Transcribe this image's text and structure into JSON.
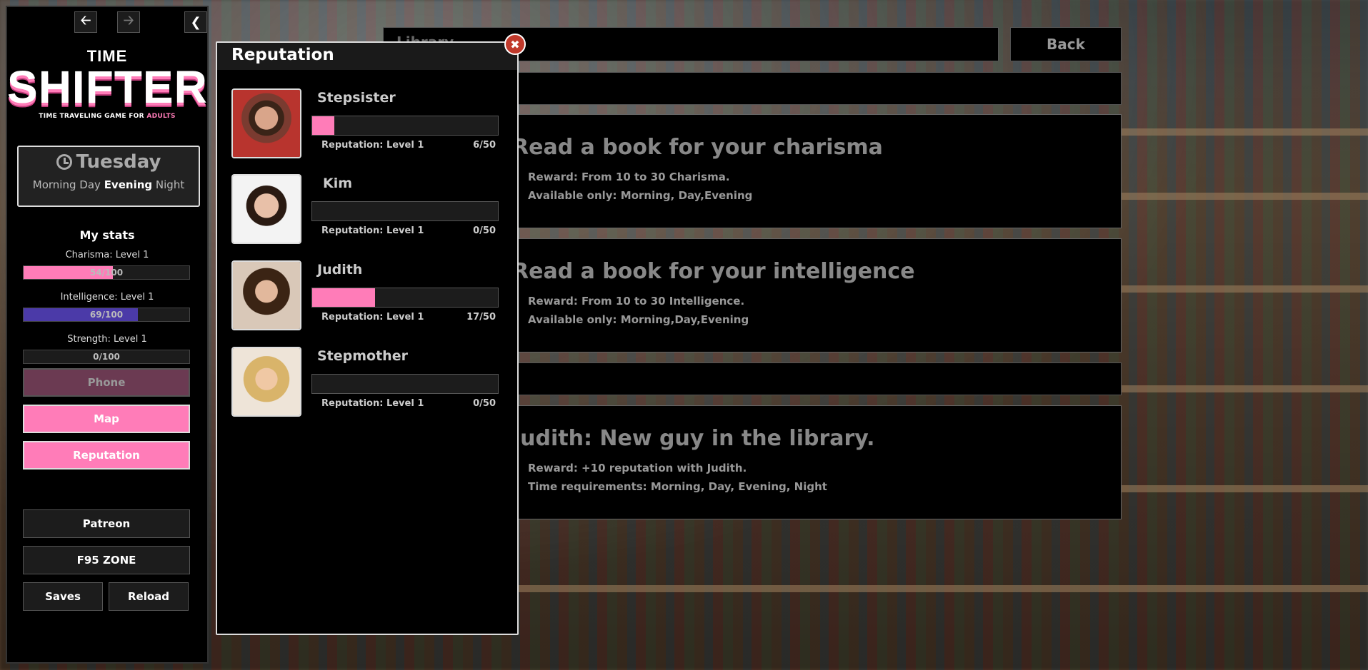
{
  "sidebar": {
    "nav": {
      "back_icon": "arrow-left-icon",
      "forward_icon": "arrow-right-icon",
      "collapse_icon": "chevron-left-icon"
    },
    "logo": {
      "line1": "TIME",
      "line2": "SHIFTER",
      "tagline": "TIME TRAVELING GAME FOR ",
      "tagline_accent": "ADULTS"
    },
    "day": {
      "name": "Tuesday",
      "times": [
        "Morning",
        "Day",
        "Evening",
        "Night"
      ],
      "current": "Evening"
    },
    "stats": {
      "title": "My stats",
      "items": [
        {
          "label": "Charisma: Level 1",
          "value": 54,
          "max": 100,
          "text": "54/100",
          "color": "#ff7cb8"
        },
        {
          "label": "Intelligence: Level 1",
          "value": 69,
          "max": 100,
          "text": "69/100",
          "color": "#4b3aa8"
        },
        {
          "label": "Strength: Level 1",
          "value": 0,
          "max": 100,
          "text": "0/100",
          "color": "#888888"
        }
      ]
    },
    "buttons": {
      "phone": "Phone",
      "map": "Map",
      "reputation": "Reputation",
      "patreon": "Patreon",
      "f95": "F95 ZONE",
      "saves": "Saves",
      "reload": "Reload"
    }
  },
  "main": {
    "location": "Library",
    "back": "Back",
    "cards": [
      {
        "title": "Read a book for your charisma",
        "line1": "Reward: From 10 to 30 Charisma.",
        "line2": "Available only: Morning, Day,Evening"
      },
      {
        "title": "Read a book for your intelligence",
        "line1": "Reward: From 10 to 30 Intelligence.",
        "line2": "Available only: Morning,Day,Evening"
      },
      {
        "title": "Judith: New guy in the library.",
        "line1": "Reward: +10 reputation with Judith.",
        "line2": "Time requirements: Morning, Day, Evening, Night"
      }
    ]
  },
  "reputation": {
    "title": "Reputation",
    "close_icon": "close-icon",
    "characters": [
      {
        "name": "Stepsister",
        "level": "Reputation: Level 1",
        "points": "6/50",
        "value": 6,
        "max": 50
      },
      {
        "name": "Kim",
        "level": "Reputation: Level 1",
        "points": "0/50",
        "value": 0,
        "max": 50
      },
      {
        "name": "Judith",
        "level": "Reputation: Level 1",
        "points": "17/50",
        "value": 17,
        "max": 50
      },
      {
        "name": "Stepmother",
        "level": "Reputation: Level 1",
        "points": "0/50",
        "value": 0,
        "max": 50
      }
    ]
  },
  "colors": {
    "accent": "#ff7cb8",
    "close": "#c0392b"
  }
}
